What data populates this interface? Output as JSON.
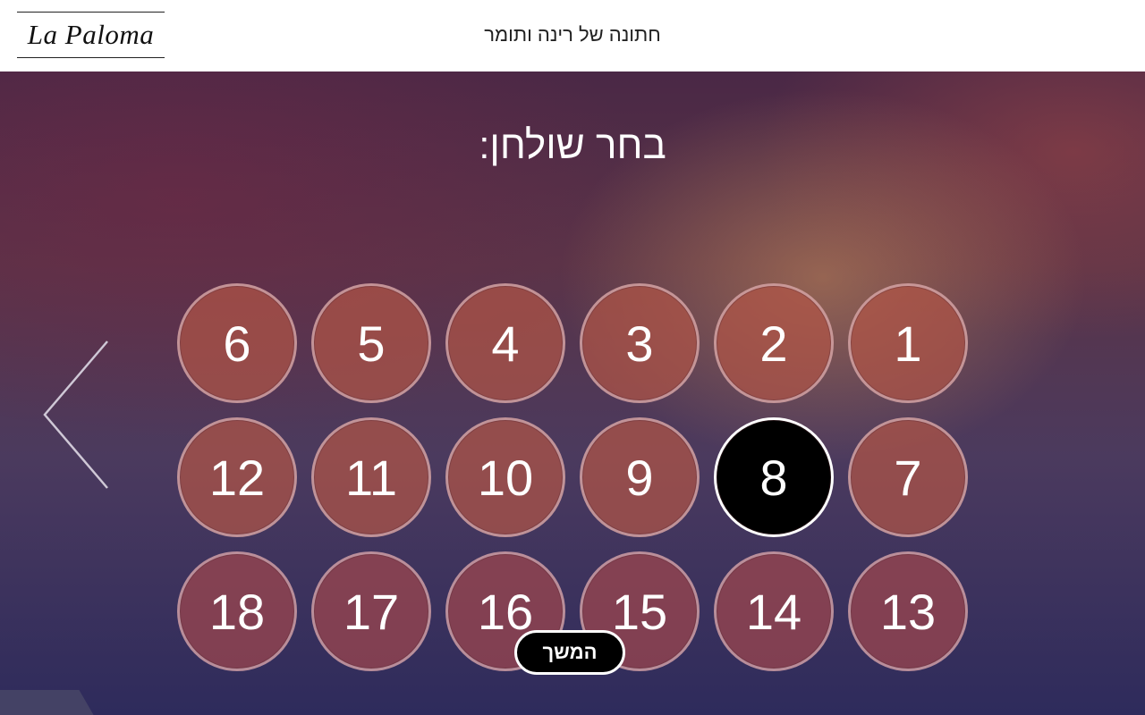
{
  "header": {
    "logo_text": "La Paloma",
    "event_title": "חתונה של רינה ותומר"
  },
  "main": {
    "heading": "בחר שולחן:",
    "tables": [
      {
        "number": "1",
        "selected": false
      },
      {
        "number": "2",
        "selected": false
      },
      {
        "number": "3",
        "selected": false
      },
      {
        "number": "4",
        "selected": false
      },
      {
        "number": "5",
        "selected": false
      },
      {
        "number": "6",
        "selected": false
      },
      {
        "number": "7",
        "selected": false
      },
      {
        "number": "8",
        "selected": true
      },
      {
        "number": "9",
        "selected": false
      },
      {
        "number": "10",
        "selected": false
      },
      {
        "number": "11",
        "selected": false
      },
      {
        "number": "12",
        "selected": false
      },
      {
        "number": "13",
        "selected": false
      },
      {
        "number": "14",
        "selected": false
      },
      {
        "number": "15",
        "selected": false
      },
      {
        "number": "16",
        "selected": false
      },
      {
        "number": "17",
        "selected": false
      },
      {
        "number": "18",
        "selected": false
      }
    ],
    "prev_icon": "chevron-left-icon",
    "continue_label": "המשך"
  },
  "colors": {
    "table_fill": "#b05446",
    "selected_fill": "#000000",
    "header_bg": "#ffffff"
  }
}
